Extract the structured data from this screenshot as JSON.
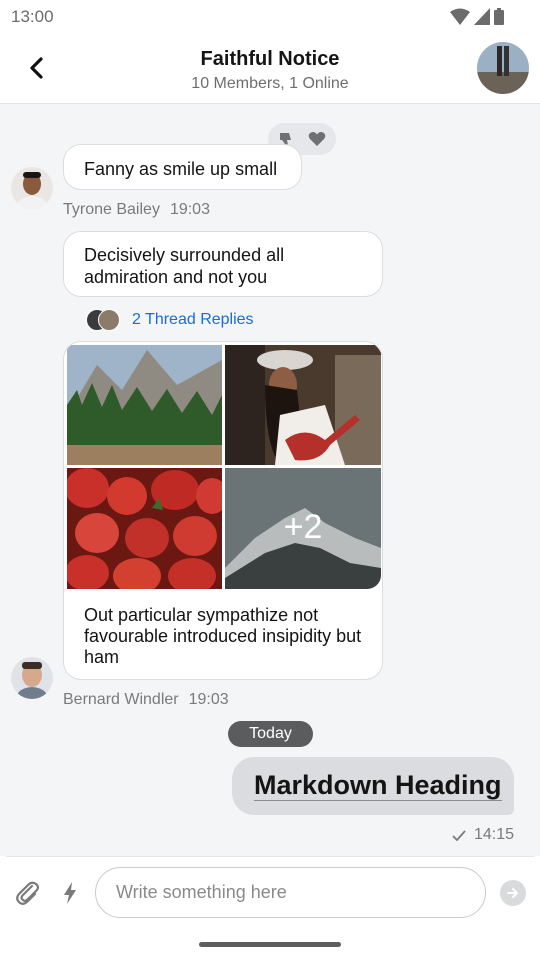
{
  "status_bar": {
    "time": "13:00",
    "icons": [
      "wifi-icon",
      "signal-icon",
      "battery-icon"
    ]
  },
  "header": {
    "title": "Faithful Notice",
    "subtitle": "10 Members, 1 Online",
    "back_icon": "chevron-left-icon"
  },
  "messages": [
    {
      "text": "Fanny as smile up small",
      "sender": "Tyrone Bailey",
      "time": "19:03",
      "reactions": [
        "thumbs-down-icon",
        "heart-icon"
      ]
    },
    {
      "text": "Decisively surrounded all admiration and not you",
      "thread_replies": "2 Thread Replies"
    },
    {
      "images": [
        "mountain-forest",
        "guitar-woman",
        "strawberries",
        "snowy-mountain"
      ],
      "more_count": "+2",
      "caption": "Out particular sympathize not favourable introduced insipidity but ham",
      "sender": "Bernard Windler",
      "time": "19:03"
    }
  ],
  "date_separator": "Today",
  "outgoing": {
    "heading": "Markdown Heading",
    "time": "14:15",
    "status_icon": "check-icon"
  },
  "composer": {
    "placeholder": "Write something here",
    "icons": [
      "paperclip-icon",
      "lightning-icon",
      "send-arrow-icon"
    ]
  },
  "colors": {
    "link": "#1c6bd6",
    "bubble_out": "#dbdcdf",
    "date_chip": "#5b5c5e",
    "background": "#f4f5f7"
  }
}
